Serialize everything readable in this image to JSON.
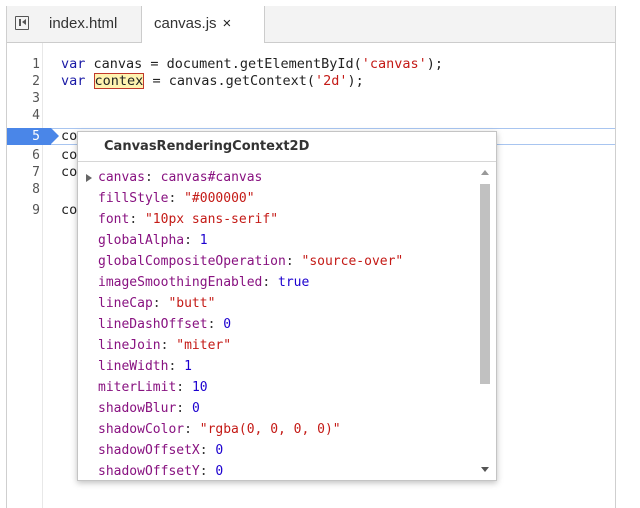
{
  "tabs": [
    {
      "label": "index.html"
    },
    {
      "label": "canvas.js",
      "close": "×"
    }
  ],
  "editor": {
    "line_numbers": [
      "1",
      "2",
      "3",
      "4",
      "5",
      "6",
      "7",
      "8",
      "9"
    ],
    "active_line": "5",
    "line1": {
      "kw": "var",
      "text1": " canvas = document.getElementById(",
      "str": "'canvas'",
      "text2": ");"
    },
    "line2": {
      "kw": "var",
      "sp": " ",
      "hl": "contex",
      "text1": " = canvas.getContext(",
      "str": "'2d'",
      "text2": ");"
    },
    "line5": "co",
    "line6": "co",
    "line7": "co",
    "line9": "co"
  },
  "popup": {
    "title": "CanvasRenderingContext2D",
    "properties": [
      {
        "key": "canvas",
        "value": "canvas#canvas",
        "type": "node"
      },
      {
        "key": "fillStyle",
        "value": "\"#000000\"",
        "type": "str"
      },
      {
        "key": "font",
        "value": "\"10px sans-serif\"",
        "type": "str"
      },
      {
        "key": "globalAlpha",
        "value": "1",
        "type": "num"
      },
      {
        "key": "globalCompositeOperation",
        "value": "\"source-over\"",
        "type": "str"
      },
      {
        "key": "imageSmoothingEnabled",
        "value": "true",
        "type": "kw"
      },
      {
        "key": "lineCap",
        "value": "\"butt\"",
        "type": "str"
      },
      {
        "key": "lineDashOffset",
        "value": "0",
        "type": "num"
      },
      {
        "key": "lineJoin",
        "value": "\"miter\"",
        "type": "str"
      },
      {
        "key": "lineWidth",
        "value": "1",
        "type": "num"
      },
      {
        "key": "miterLimit",
        "value": "10",
        "type": "num"
      },
      {
        "key": "shadowBlur",
        "value": "0",
        "type": "num"
      },
      {
        "key": "shadowColor",
        "value": "\"rgba(0, 0, 0, 0)\"",
        "type": "str"
      },
      {
        "key": "shadowOffsetX",
        "value": "0",
        "type": "num"
      },
      {
        "key": "shadowOffsetY",
        "value": "0",
        "type": "num"
      }
    ]
  }
}
